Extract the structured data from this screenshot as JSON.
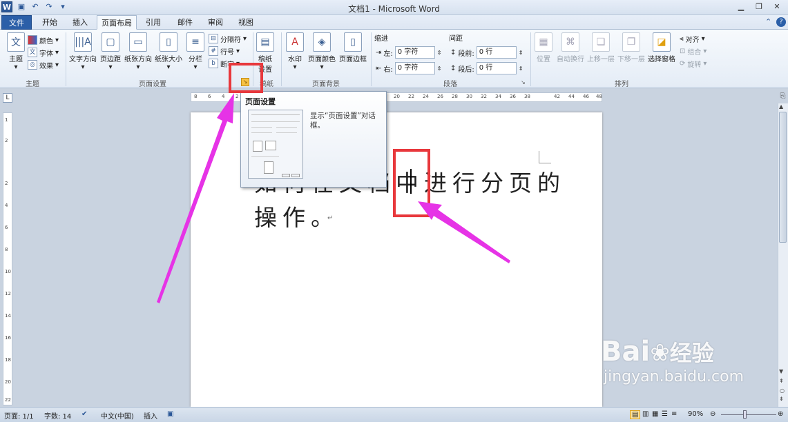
{
  "window": {
    "title": "文档1 - Microsoft Word",
    "app_icon_letter": "W"
  },
  "quick_access": [
    "save-icon",
    "undo-icon",
    "redo-icon",
    "customize-icon"
  ],
  "tabs": [
    {
      "label": "文件",
      "kind": "file"
    },
    {
      "label": "开始"
    },
    {
      "label": "插入"
    },
    {
      "label": "页面布局",
      "active": true
    },
    {
      "label": "引用"
    },
    {
      "label": "邮件"
    },
    {
      "label": "审阅"
    },
    {
      "label": "视图"
    }
  ],
  "ribbon": {
    "groups": {
      "theme": "主题",
      "page_setup": "页面设置",
      "manuscript": "稿纸",
      "page_background": "页面背景",
      "paragraph": "段落",
      "arrange": "排列"
    },
    "theme": {
      "theme_label": "主题",
      "colors": "颜色",
      "fonts": "字体",
      "effects": "效果"
    },
    "page_setup": {
      "text_direction": "文字方向",
      "margins": "页边距",
      "orientation": "纸张方向",
      "size": "纸张大小",
      "columns": "分栏",
      "breaks": "分隔符",
      "line_numbers": "行号",
      "hyphenation": "断字"
    },
    "manuscript": {
      "label_line1": "稿纸",
      "label_line2": "设置"
    },
    "page_background": {
      "watermark": "水印",
      "page_color": "页面颜色",
      "page_borders": "页面边框"
    },
    "paragraph": {
      "indent_header": "缩进",
      "spacing_header": "间距",
      "left_label": "左:",
      "left_value": "0 字符",
      "right_label": "右:",
      "right_value": "0 字符",
      "before_label": "段前:",
      "before_value": "0 行",
      "after_label": "段后:",
      "after_value": "0 行"
    },
    "arrange": {
      "position": "位置",
      "wrap_text": "自动换行",
      "bring_forward": "上移一层",
      "send_backward": "下移一层",
      "selection_pane": "选择窗格",
      "align": "对齐",
      "group": "组合",
      "rotate": "旋转"
    }
  },
  "ruler_numbers": [
    "8",
    "6",
    "4",
    "2",
    "20",
    "22",
    "24",
    "26",
    "28",
    "30",
    "32",
    "34",
    "36",
    "38",
    "42",
    "44",
    "46",
    "48"
  ],
  "vruler_numbers": [
    "1",
    "2",
    "2",
    "4",
    "6",
    "8",
    "10",
    "12",
    "14",
    "16",
    "18",
    "20",
    "22"
  ],
  "tooltip": {
    "title": "页面设置",
    "description": "显示“页面设置”对话框。"
  },
  "document": {
    "line1": "如何在文档中进行分页的",
    "line2": "操作。",
    "paragraph_mark": "↵"
  },
  "statusbar": {
    "page": "页面: 1/1",
    "words": "字数: 14",
    "language": "中文(中国)",
    "mode": "插入",
    "zoom": "90%"
  },
  "watermark": {
    "brand": "Bai",
    "brand_suffix": "经验",
    "url": "jingyan.baidu.com"
  },
  "colors": {
    "annotation_red": "#e8383c",
    "annotation_arrow": "#e633e6",
    "file_tab": "#2b5fa8"
  }
}
